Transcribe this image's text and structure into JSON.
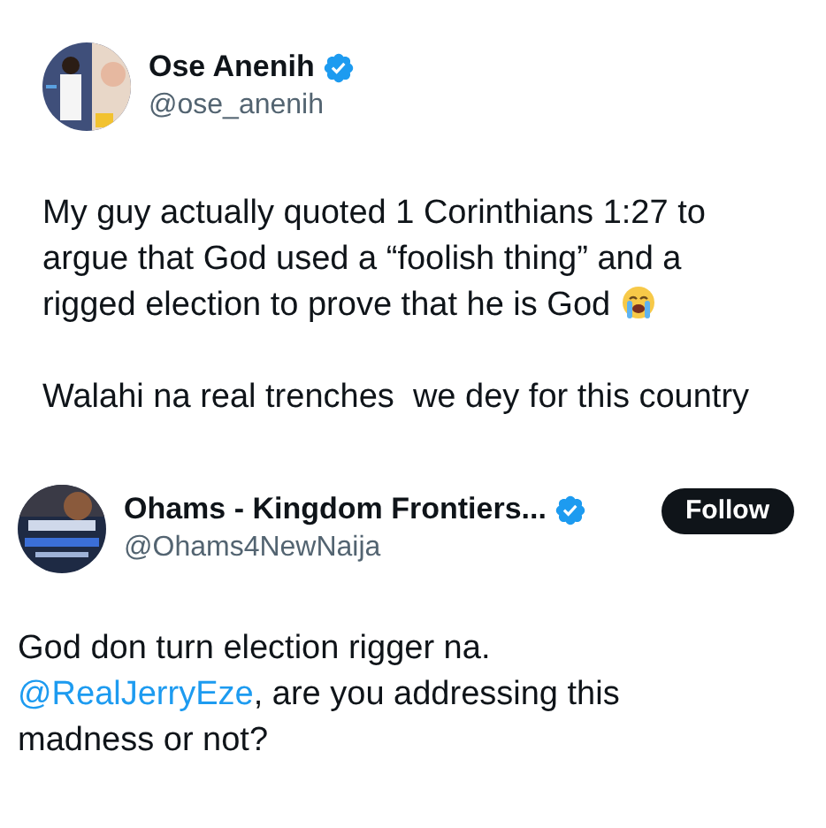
{
  "tweets": [
    {
      "name": "Ose Anenih",
      "handle": "@ose_anenih",
      "verified": true,
      "avatar": {
        "kind": "picture"
      },
      "paragraphs": [
        [
          {
            "kind": "text",
            "text": "My guy actually quoted 1 Corinthians 1:27 to argue that God used a “foolish thing” and a rigged election to prove that he is God"
          },
          {
            "kind": "emoji"
          }
        ],
        [
          {
            "kind": "text",
            "text": "Walahi na real trenches  we dey for this country"
          }
        ]
      ]
    },
    {
      "name": "Ohams - Kingdom Frontiers...",
      "handle": "@Ohams4NewNaija",
      "verified": true,
      "follow_button": "Follow",
      "avatar": {
        "kind": "picture"
      },
      "paragraphs": [
        [
          {
            "kind": "text",
            "text": "God don turn election rigger na. "
          },
          {
            "kind": "mention",
            "text": "@RealJerryEze"
          },
          {
            "kind": "text",
            "text": ", are you addressing this madness or not?"
          }
        ]
      ]
    }
  ]
}
